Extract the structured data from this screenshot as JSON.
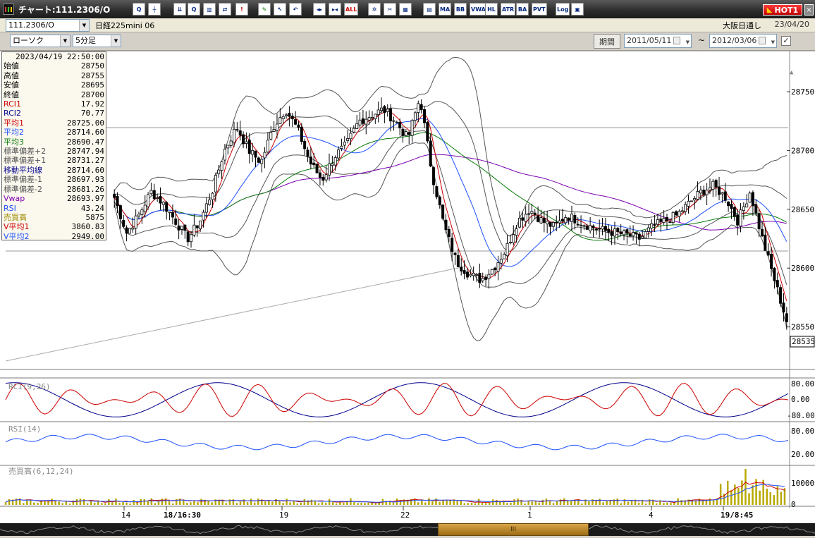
{
  "window": {
    "title": "チャート:111.2306/O",
    "hot_label": "HOT1",
    "close_label": "×"
  },
  "symbol": {
    "code": "111.2306/O",
    "name": "日経225mini 06",
    "market": "大阪日通し",
    "date": "23/04/20"
  },
  "toolbar": {
    "chart_type": "ローソク",
    "interval": "5分足",
    "period_label": "期間",
    "date_from": "2011/05/11",
    "date_to": "2012/03/06",
    "separator": "~",
    "icons": [
      {
        "name": "zoom-icon",
        "label": "Q"
      },
      {
        "name": "crosshair-icon",
        "label": "┼"
      },
      {
        "name": "download-icon",
        "label": "⇊"
      },
      {
        "name": "magnify-icon",
        "label": "Q"
      },
      {
        "name": "bar-chart-icon",
        "label": "▥"
      },
      {
        "name": "compare-icon",
        "label": "⇄"
      },
      {
        "name": "warning-icon",
        "label": "!"
      },
      {
        "name": "pencil-icon",
        "label": "✎"
      },
      {
        "name": "pointer-icon",
        "label": "↖"
      },
      {
        "name": "undo-icon",
        "label": "↶"
      },
      {
        "name": "candle-shrink-icon",
        "label": "◂▸"
      },
      {
        "name": "candle-expand-icon",
        "label": "▸◂"
      },
      {
        "name": "all-icon",
        "label": "ALL"
      },
      {
        "name": "settings-icon",
        "label": "✲"
      },
      {
        "name": "wrench-icon",
        "label": "✂"
      },
      {
        "name": "palette-icon",
        "label": "▦"
      },
      {
        "name": "indicator-list-icon",
        "label": "▤"
      },
      {
        "name": "ma-icon",
        "label": "MA"
      },
      {
        "name": "bb-icon",
        "label": "BB"
      },
      {
        "name": "vwap-icon",
        "label": "VWAP"
      },
      {
        "name": "hl-icon",
        "label": "HL"
      },
      {
        "name": "atr-icon",
        "label": "ATR"
      },
      {
        "name": "ba-icon",
        "label": "BA"
      },
      {
        "name": "pvt-icon",
        "label": "PVT"
      },
      {
        "name": "log-icon",
        "label": "Log"
      },
      {
        "name": "window-icon",
        "label": "▣"
      }
    ]
  },
  "info_panel": {
    "datetime": "2023/04/19  22:50:00",
    "rows": [
      {
        "label": "始値",
        "value": "28750",
        "color": "#000000"
      },
      {
        "label": "高値",
        "value": "28755",
        "color": "#000000"
      },
      {
        "label": "安値",
        "value": "28695",
        "color": "#000000"
      },
      {
        "label": "終値",
        "value": "28700",
        "color": "#000000"
      },
      {
        "label": "RCI1",
        "value": "17.92",
        "color": "#cc0000"
      },
      {
        "label": "RCI2",
        "value": "70.77",
        "color": "#00008b"
      },
      {
        "label": "平均1",
        "value": "28725.00",
        "color": "#cc0000"
      },
      {
        "label": "平均2",
        "value": "28714.60",
        "color": "#1e50ff"
      },
      {
        "label": "平均3",
        "value": "28690.47",
        "color": "#0a7d0a"
      },
      {
        "label": "標準偏差+2",
        "value": "28747.94",
        "color": "#555555"
      },
      {
        "label": "標準偏差+1",
        "value": "28731.27",
        "color": "#555555"
      },
      {
        "label": "移動平均線",
        "value": "28714.60",
        "color": "#00008b"
      },
      {
        "label": "標準偏差-1",
        "value": "28697.93",
        "color": "#555555"
      },
      {
        "label": "標準偏差-2",
        "value": "28681.26",
        "color": "#555555"
      },
      {
        "label": "Vwap",
        "value": "28693.97",
        "color": "#7a00b0"
      },
      {
        "label": "RSI",
        "value": "43.24",
        "color": "#1e50ff"
      },
      {
        "label": "売買高",
        "value": "5875",
        "color": "#9a8a00"
      },
      {
        "label": "V平均1",
        "value": "3860.83",
        "color": "#cc0000"
      },
      {
        "label": "V平均2",
        "value": "2949.00",
        "color": "#1e50ff"
      }
    ]
  },
  "price_axis": {
    "ticks": [
      "28750",
      "28700",
      "28650",
      "28600",
      "28550"
    ],
    "current_price": "28535"
  },
  "rci_panel": {
    "label": "RCI(9,26)",
    "ticks": [
      "80.00",
      "0.00",
      "-80.00"
    ]
  },
  "rsi_panel": {
    "label": "RSI(14)",
    "ticks": [
      "80.00",
      "20.00"
    ]
  },
  "volume_panel": {
    "label": "売買高(6,12,24)",
    "ticks": [
      "10000",
      "0"
    ]
  },
  "time_axis": {
    "labels": [
      "14",
      "18/16:30",
      "19",
      "22",
      "1",
      "4",
      "19/8:45"
    ]
  },
  "scrollbar": {
    "thumb_label": "III"
  },
  "colors": {
    "candle_up": "#ffffff",
    "candle_down": "#000000",
    "ma1": "#cc0000",
    "ma2": "#1e50ff",
    "ma3": "#0a7d0a",
    "bollinger": "#555555",
    "vwap": "#7a00b0",
    "rci1": "#cc0000",
    "rci2": "#00008b",
    "rsi": "#1e50ff",
    "volume": "#b8a800"
  },
  "chart_data": {
    "type": "candlestick",
    "price_range": [
      28515,
      28780
    ],
    "rci_range": [
      -100,
      100
    ],
    "rsi_range": [
      0,
      100
    ],
    "volume_range": [
      0,
      12500
    ],
    "close_keypoints": [
      28660,
      28630,
      28645,
      28665,
      28655,
      28640,
      28625,
      28640,
      28665,
      28700,
      28720,
      28700,
      28690,
      28720,
      28735,
      28718,
      28690,
      28675,
      28695,
      28705,
      28725,
      28730,
      28735,
      28725,
      28710,
      28745,
      28680,
      28635,
      28605,
      28595,
      28590,
      28600,
      28615,
      28640,
      28650,
      28640,
      28635,
      28645,
      28640,
      28635,
      28632,
      28630,
      28628,
      28625,
      28635,
      28640,
      28645,
      28655,
      28665,
      28670,
      28660,
      28640,
      28665,
      28625,
      28590,
      28555
    ]
  }
}
